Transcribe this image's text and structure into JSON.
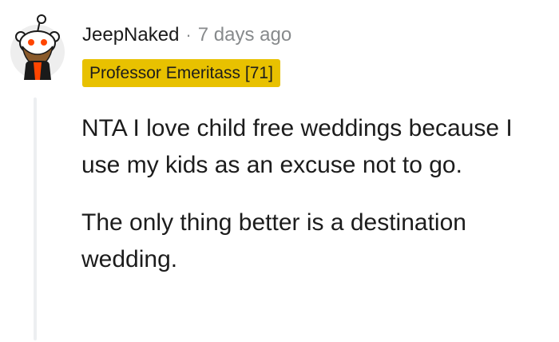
{
  "comment": {
    "username": "JeepNaked",
    "separator": "·",
    "timestamp": "7 days ago",
    "flair": "Professor Emeritass [71]",
    "paragraphs": [
      "NTA I love child free weddings because I use my kids as an excuse not to go.",
      "The only thing better is a destination wedding."
    ]
  },
  "colors": {
    "flair_bg": "#e8c100",
    "text": "#1c1c1c",
    "muted": "#878a8c",
    "thread_line": "#edeff1",
    "avatar_orange": "#ff4500"
  },
  "icons": {
    "avatar": "reddit-snoo-avatar"
  }
}
